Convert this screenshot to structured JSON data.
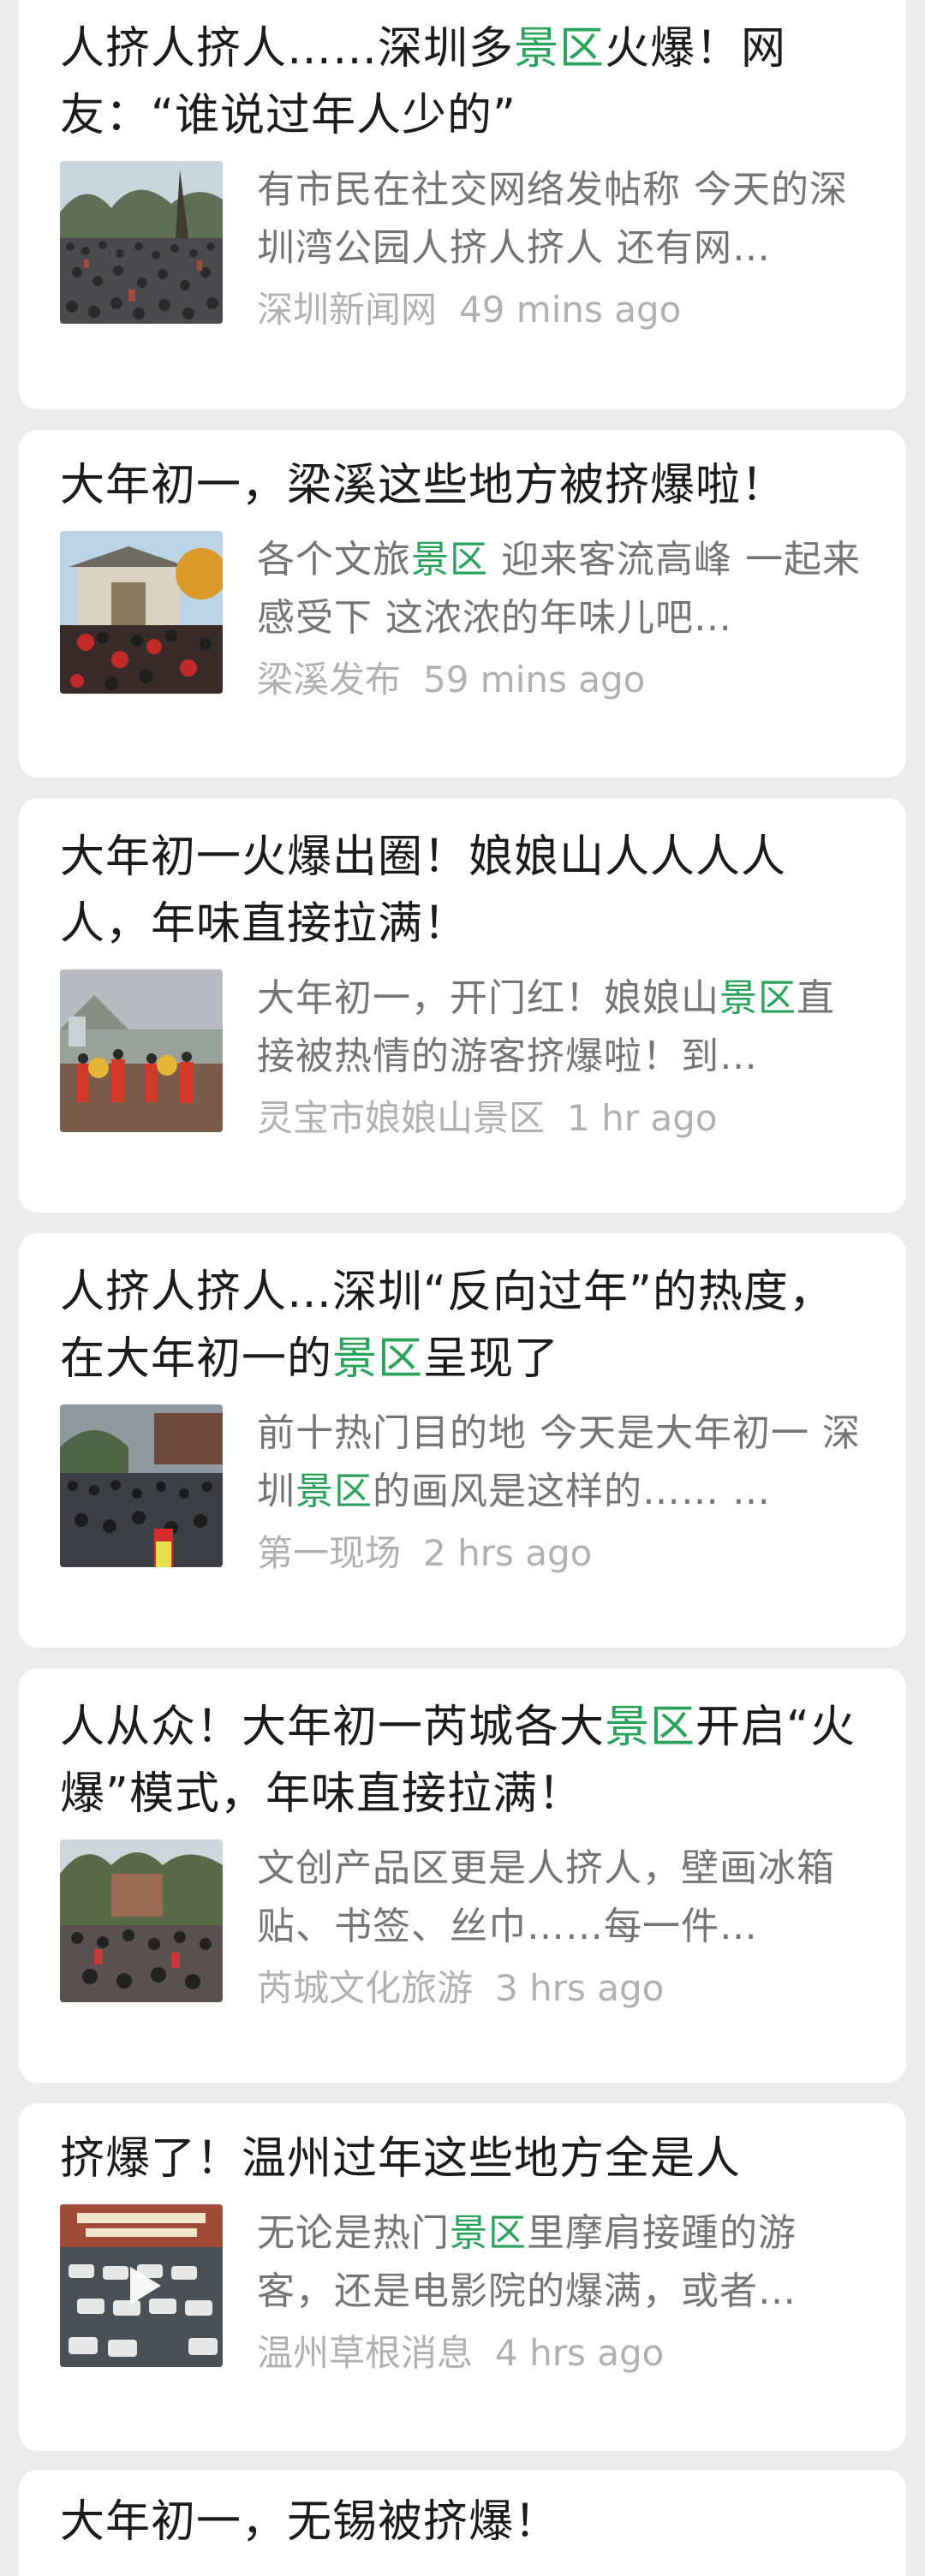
{
  "accent_color": "#2aa35a",
  "articles": [
    {
      "title_parts": [
        "人挤人挤人……深圳多",
        "景区",
        "火爆！网友：“谁说过年人少的”"
      ],
      "snippet_parts": [
        "有市民在社交网络发帖称 今天的深圳湾公园人挤人挤人 还有网…",
        "",
        ""
      ],
      "source": "深圳新闻网",
      "time": "49 mins ago",
      "thumbnail": "crowd-park-photo"
    },
    {
      "title_parts": [
        "大年初一，梁溪这些地方被挤爆啦！",
        "",
        ""
      ],
      "snippet_parts": [
        "各个文旅",
        "景区",
        " 迎来客流高峰 一起来感受下 这浓浓的年味儿吧…"
      ],
      "source": "梁溪发布",
      "time": "59 mins ago",
      "thumbnail": "temple-gate-crowd-photo"
    },
    {
      "title_parts": [
        "大年初一火爆出圈！娘娘山人人人人人，年味直接拉满！",
        "",
        ""
      ],
      "snippet_parts": [
        "大年初一，开门红！娘娘山",
        "景区",
        "直接被热情的游客挤爆啦！到…"
      ],
      "source": "灵宝市娘娘山景区",
      "time": "1 hr ago",
      "thumbnail": "lion-dance-photo"
    },
    {
      "title_parts": [
        "人挤人挤人…深圳“反向过年”的热度，在大年初一的",
        "景区",
        "呈现了"
      ],
      "snippet_parts": [
        "前十热门目的地 今天是大年初一 深圳",
        "景区",
        "的画风是这样的…… …"
      ],
      "source": "第一现场",
      "time": "2 hrs ago",
      "thumbnail": "street-crowd-photo"
    },
    {
      "title_parts": [
        "人从众！大年初一芮城各大",
        "景区",
        "开启“火爆”模式，年味直接拉满！"
      ],
      "snippet_parts": [
        "文创产品区更是人挤人，壁画冰箱贴、书签、丝巾……每一件…",
        "",
        ""
      ],
      "source": "芮城文化旅游",
      "time": "3 hrs ago",
      "thumbnail": "square-crowd-photo"
    },
    {
      "title_parts": [
        "挤爆了！温州过年这些地方全是人",
        "",
        ""
      ],
      "snippet_parts": [
        "无论是热门",
        "景区",
        "里摩肩接踵的游客，还是电影院的爆满，或者…"
      ],
      "source": "温州草根消息",
      "time": "4 hrs ago",
      "thumbnail": "parking-lot-video",
      "has_play_icon": true
    },
    {
      "title_parts": [
        "大年初一，无锡被挤爆！",
        "",
        ""
      ],
      "snippet_parts": [
        "",
        "",
        ""
      ],
      "source": "",
      "time": "",
      "thumbnail": ""
    }
  ]
}
